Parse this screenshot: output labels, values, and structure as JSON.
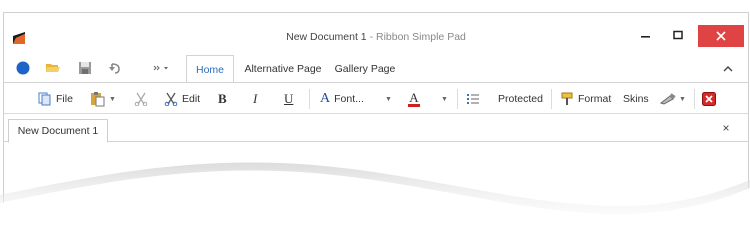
{
  "window": {
    "title_main": "New Document 1",
    "title_sub": " - Ribbon Simple Pad"
  },
  "quick_access": {
    "icons": [
      "app-menu-icon",
      "open-folder-icon",
      "save-icon",
      "undo-icon",
      "customize-icon"
    ]
  },
  "tabs": [
    {
      "label": "Home",
      "active": true
    },
    {
      "label": "Alternative Page",
      "active": false
    },
    {
      "label": "Gallery Page",
      "active": false
    }
  ],
  "ribbon": {
    "file": "File",
    "edit": "Edit",
    "bold": "B",
    "italic": "I",
    "underline": "U",
    "font": "Font...",
    "font_color": "A",
    "protected": "Protected",
    "format": "Format",
    "skins": "Skins"
  },
  "document": {
    "tab_label": "New Document 1",
    "close_glyph": "×"
  },
  "colors": {
    "accent": "#2a6ebb",
    "close_button": "#e04343",
    "app_menu_circle": "#1e63c6"
  }
}
